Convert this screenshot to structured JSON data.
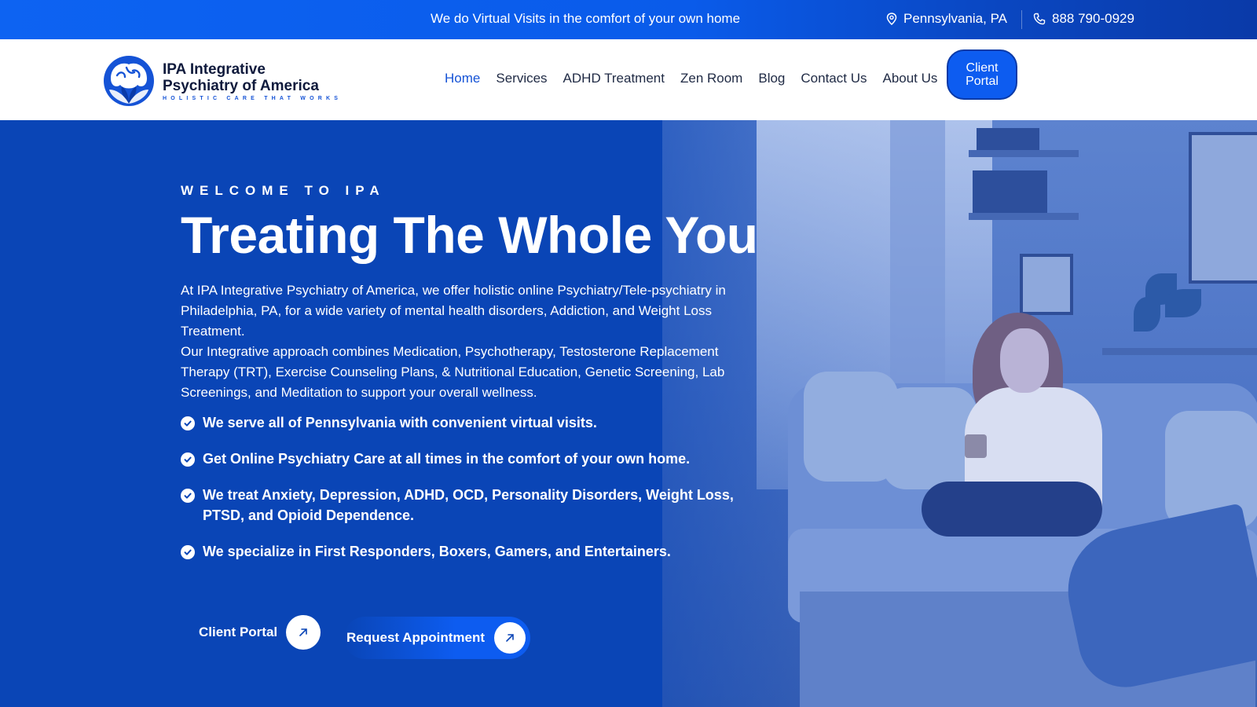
{
  "topbar": {
    "message": "We do Virtual Visits in the comfort of your own home",
    "location": "Pennsylvania, PA",
    "phone": "888 790-0929"
  },
  "logo": {
    "line1": "IPA Integrative",
    "line2": "Psychiatry of America",
    "tagline": "HOLISTIC CARE THAT WORKS"
  },
  "nav": {
    "items": [
      {
        "label": "Home",
        "active": true
      },
      {
        "label": "Services"
      },
      {
        "label": "ADHD Treatment"
      },
      {
        "label": "Zen Room"
      },
      {
        "label": "Blog"
      },
      {
        "label": "Contact Us"
      },
      {
        "label": "About Us"
      }
    ],
    "portal_button": "Client Portal"
  },
  "hero": {
    "eyebrow": "WELCOME TO IPA",
    "title": "Treating The Whole You",
    "paragraph1": "At IPA Integrative Psychiatry of America, we offer holistic online Psychiatry/Tele-psychiatry in Philadelphia, PA, for a wide variety of mental health disorders, Addiction, and Weight Loss Treatment.",
    "paragraph2": "Our Integrative approach combines Medication, Psychotherapy, Testosterone Replacement Therapy (TRT), Exercise Counseling Plans, & Nutritional Education, Genetic Screening, Lab Screenings, and Meditation to support your overall wellness.",
    "bullets": [
      "We serve all of Pennsylvania with convenient virtual visits.",
      "Get Online Psychiatry Care at all times in the comfort of your own home.",
      "We treat Anxiety, Depression, ADHD, OCD, Personality Disorders, Weight Loss, PTSD, and Opioid Dependence.",
      "We specialize in First Responders, Boxers, Gamers, and Entertainers."
    ],
    "cta_portal": "Client Portal",
    "cta_appointment": "Request Appointment"
  },
  "colors": {
    "brand_blue": "#0d5cf0",
    "hero_blue": "#0a45b6",
    "nav_active": "#1553d6"
  },
  "icons": {
    "location": "map-pin-icon",
    "phone": "phone-icon",
    "check": "check-circle-icon",
    "arrow": "arrow-up-right-icon"
  }
}
